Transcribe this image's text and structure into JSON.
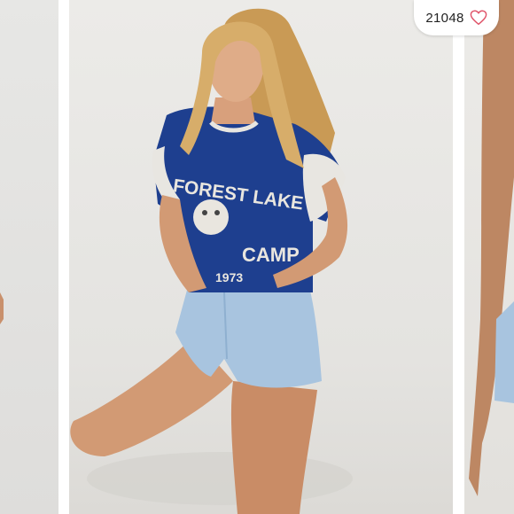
{
  "listing": {
    "like_count": "21048",
    "heart_icon": "heart-outline-icon",
    "heart_color": "#e0566b"
  },
  "photo": {
    "shirt_text_line1": "FOREST LAKE",
    "shirt_text_line2": "CAMP",
    "shirt_text_line3": "1973",
    "shirt_color": "#1e3f8f",
    "accent_color": "#e8e6e1"
  }
}
